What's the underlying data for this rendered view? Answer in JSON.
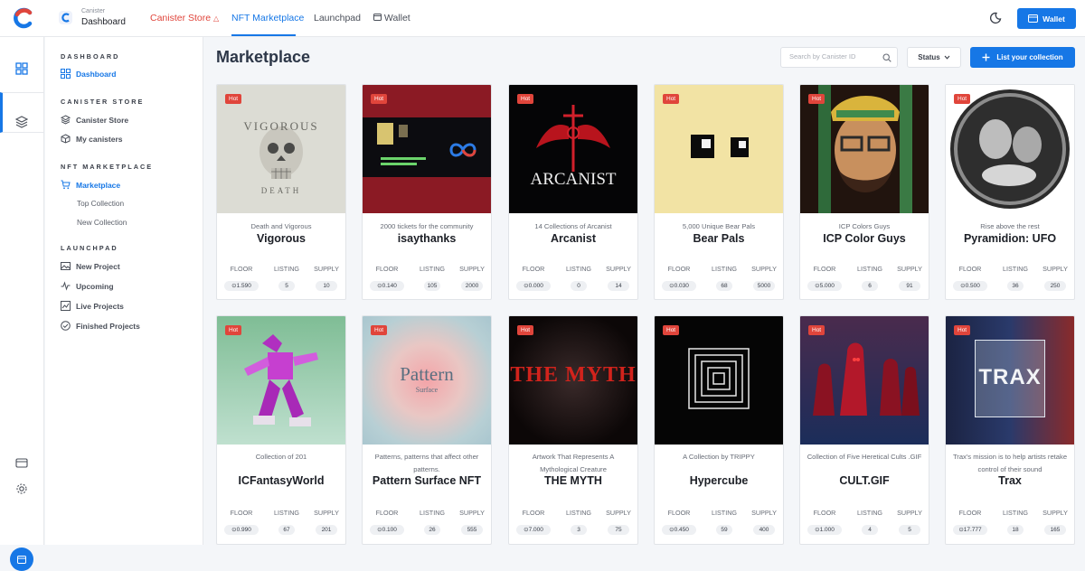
{
  "brand": {
    "small": "Canister",
    "big": "Dashboard"
  },
  "nav": {
    "canister_store": "Canister Store",
    "nft_marketplace": "NFT Marketplace",
    "launchpad": "Launchpad",
    "wallet": "Wallet"
  },
  "wallet_button": "Wallet",
  "colors": {
    "accent": "#1677e6",
    "hot": "#e0453b"
  },
  "sidebar": {
    "dashboard_header": "DASHBOARD",
    "dashboard": "Dashboard",
    "canister_header": "CANISTER STORE",
    "canister_store": "Canister Store",
    "my_canisters": "My canisters",
    "nft_header": "NFT MARKETPLACE",
    "marketplace": "Marketplace",
    "top_collection": "Top Collection",
    "new_collection": "New Collection",
    "launchpad_header": "LAUNCHPAD",
    "new_project": "New Project",
    "upcoming": "Upcoming",
    "live_projects": "Live Projects",
    "finished_projects": "Finished Projects"
  },
  "main": {
    "heading": "Marketplace",
    "search_placeholder": "Search by Canister ID",
    "status": "Status",
    "list_button": "List your collection"
  },
  "stats_labels": {
    "floor": "FLOOR",
    "listing": "LISTING",
    "supply": "SUPPLY"
  },
  "cards": [
    {
      "hot": "Hot",
      "subtitle": "Death and Vigorous",
      "title": "Vigorous",
      "floor": "⊙1.590",
      "listing": "5",
      "supply": "10"
    },
    {
      "hot": "Hot",
      "subtitle": "2000 tickets for the community",
      "title": "isaythanks",
      "floor": "⊙0.140",
      "listing": "105",
      "supply": "2000"
    },
    {
      "hot": "Hot",
      "subtitle": "14 Collections of Arcanist",
      "title": "Arcanist",
      "floor": "⊙0.000",
      "listing": "0",
      "supply": "14"
    },
    {
      "hot": "Hot",
      "subtitle": "5,000 Unique Bear Pals",
      "title": "Bear Pals",
      "floor": "⊙0.030",
      "listing": "68",
      "supply": "5000"
    },
    {
      "hot": "Hot",
      "subtitle": "ICP Colors Guys",
      "title": "ICP Color Guys",
      "floor": "⊙5.000",
      "listing": "6",
      "supply": "91"
    },
    {
      "hot": "Hot",
      "subtitle": "Rise above the rest",
      "title": "Pyramidion: UFO",
      "floor": "⊙0.500",
      "listing": "36",
      "supply": "250"
    },
    {
      "hot": "Hot",
      "subtitle": "Collection of 201",
      "title": "ICFantasyWorld",
      "floor": "⊙0.990",
      "listing": "67",
      "supply": "201"
    },
    {
      "hot": "Hot",
      "subtitle": "Patterns, patterns that affect other patterns.",
      "title": "Pattern Surface NFT",
      "floor": "⊙0.100",
      "listing": "26",
      "supply": "555"
    },
    {
      "hot": "Hot",
      "subtitle": "Artwork That Represents A Mythological Creature",
      "title": "THE MYTH",
      "floor": "⊙7.000",
      "listing": "3",
      "supply": "75"
    },
    {
      "hot": "Hot",
      "subtitle": "A Collection by TRIPPY",
      "title": "Hypercube",
      "floor": "⊙0.450",
      "listing": "59",
      "supply": "400"
    },
    {
      "hot": "Hot",
      "subtitle": "Collection of Five Heretical Cults .GIF",
      "title": "CULT.GIF",
      "floor": "⊙1.000",
      "listing": "4",
      "supply": "5"
    },
    {
      "hot": "Hot",
      "subtitle": "Trax's mission is to help artists retake control of their sound",
      "title": "Trax",
      "floor": "⊙17.777",
      "listing": "18",
      "supply": "165"
    }
  ],
  "art_text": {
    "vigorous_top": "VIGOROUS",
    "vigorous_bottom": "DEATH",
    "arcanist": "ARCANIST",
    "pattern": "Pattern",
    "pattern_sub": "Surface",
    "myth": "THE MYTH",
    "trax": "TRAX"
  }
}
